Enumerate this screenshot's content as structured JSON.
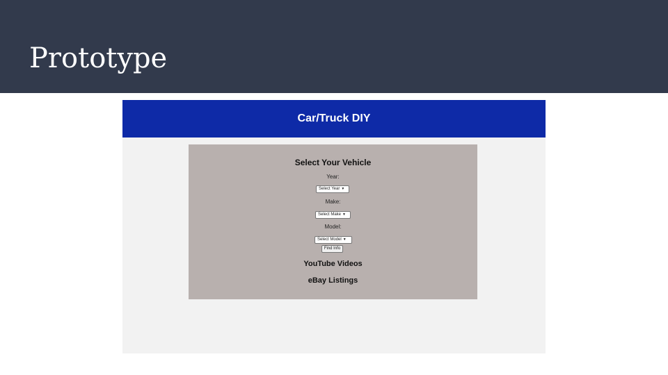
{
  "slide": {
    "title": "Prototype",
    "header_color": "#323a4c"
  },
  "site": {
    "title": "Car/Truck DIY",
    "header_color": "#0e2aa7",
    "panel_color": "#b8b0ae"
  },
  "form": {
    "heading": "Select Your Vehicle",
    "year_label": "Year:",
    "year_selected": "Select Year",
    "make_label": "Make:",
    "make_selected": "Select Make",
    "model_label": "Model:",
    "model_selected": "Select Model",
    "submit_label": "Find Info"
  },
  "sections": {
    "youtube": "YouTube Videos",
    "ebay": "eBay Listings"
  },
  "icons": {
    "dropdown": "chevron-down-icon"
  }
}
